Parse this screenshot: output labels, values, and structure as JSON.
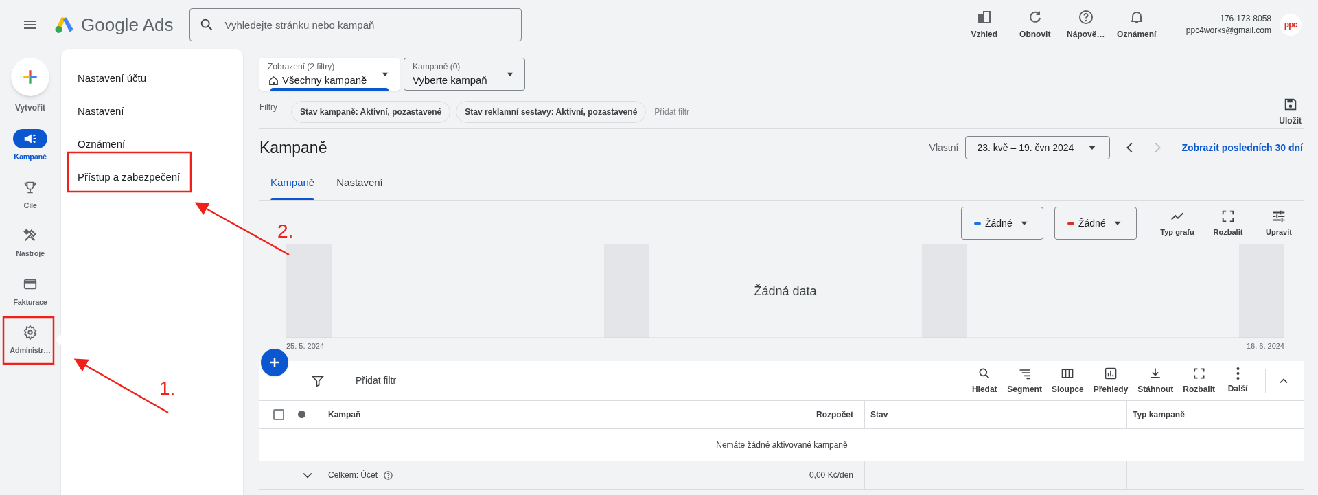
{
  "top_bar": {
    "logo_text": "Google Ads",
    "search": {
      "placeholder": "Vyhledejte stránku nebo kampaň"
    },
    "actions": [
      {
        "label": "Vzhled"
      },
      {
        "label": "Obnovit"
      },
      {
        "label": "Nápově…"
      },
      {
        "label": "Oznámení"
      }
    ],
    "account": {
      "id": "176-173-8058",
      "email": "ppc4works@gmail.com",
      "avatar_text": "ppc"
    }
  },
  "create_button": {
    "label": "Vytvořit"
  },
  "rail": [
    {
      "label": "Kampaně",
      "selected": true
    },
    {
      "label": "Cíle",
      "selected": false
    },
    {
      "label": "Nástroje",
      "selected": false
    },
    {
      "label": "Fakturace",
      "selected": false
    },
    {
      "label": "Administr…",
      "selected": false
    }
  ],
  "admin_menu": [
    "Nastavení účtu",
    "Nastavení",
    "Oznámení",
    "Přístup a zabezpečení"
  ],
  "view_selector": {
    "label": "Zobrazení (2 filtry)",
    "value": "Všechny kampaně"
  },
  "campaign_selector": {
    "label": "Kampaně (0)",
    "value": "Vyberte kampaň"
  },
  "filters": {
    "label": "Filtry",
    "chips": [
      "Stav kampaně: Aktivní, pozastavené",
      "Stav reklamní sestavy: Aktivní, pozastavené"
    ],
    "add": "Přidat filtr",
    "save": "Uložit"
  },
  "page": {
    "title": "Kampaně",
    "date_label": "Vlastní",
    "date_range": "23. kvě – 19. čvn 2024",
    "show_last": "Zobrazit posledních 30 dní"
  },
  "tabs": [
    {
      "label": "Kampaně",
      "selected": true
    },
    {
      "label": "Nastavení",
      "selected": false
    }
  ],
  "chart": {
    "metrics": [
      {
        "label": "Žádné",
        "color": "#1a73e8"
      },
      {
        "label": "Žádné",
        "color": "#d93025"
      }
    ],
    "tools": [
      "Typ grafu",
      "Rozbalit",
      "Upravit"
    ],
    "no_data": "Žádná data",
    "x_labels": [
      "25. 5. 2024",
      "16. 6. 2024"
    ]
  },
  "table": {
    "add_filter": "Přidat filtr",
    "tools": [
      "Hledat",
      "Segment",
      "Sloupce",
      "Přehledy",
      "Stáhnout",
      "Rozbalit",
      "Další"
    ],
    "select_all_checked": false,
    "columns": [
      "Kampaň",
      "Rozpočet",
      "Stav",
      "Typ kampaně"
    ],
    "empty_message": "Nemáte žádné aktivované kampaně",
    "total": {
      "label": "Celkem: Účet",
      "budget": "0,00 Kč/den"
    }
  },
  "annotations": [
    {
      "label": "1."
    },
    {
      "label": "2."
    }
  ]
}
